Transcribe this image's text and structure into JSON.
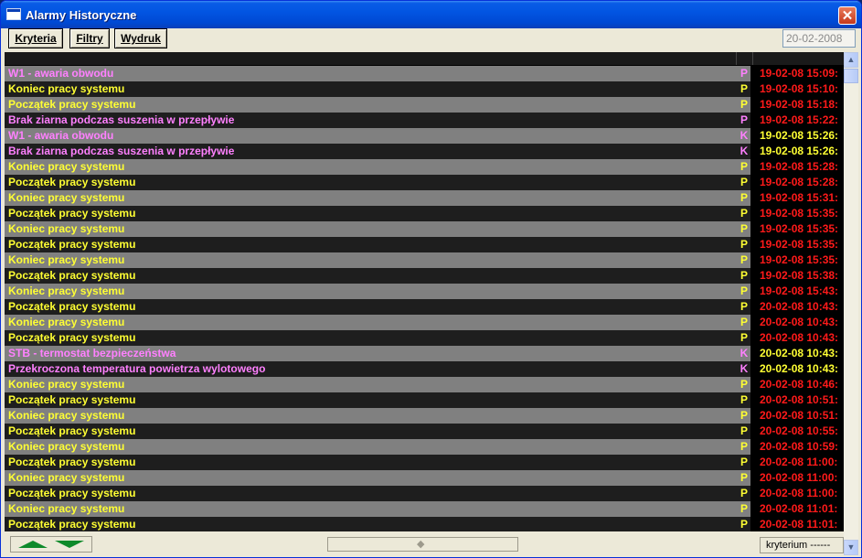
{
  "window": {
    "title": "Alarmy Historyczne",
    "close_glyph": "✕"
  },
  "toolbar": {
    "buttons": [
      {
        "label": "Kryteria"
      },
      {
        "label": "Filtry"
      },
      {
        "label": "Wydruk"
      }
    ],
    "date": "20-02-2008"
  },
  "colors": {
    "yellow": "#ffff33",
    "pink": "#ff80ff",
    "red": "#ff1a1a",
    "row_light": "#808080",
    "row_dark": "#1e1e1e"
  },
  "alarms": [
    {
      "text": "W1 - awaria obwodu",
      "type": "P",
      "date": "19-02-08  15:09:",
      "text_color": "pink",
      "date_color": "red"
    },
    {
      "text": "Koniec pracy systemu",
      "type": "P",
      "date": "19-02-08  15:10:",
      "text_color": "yellow",
      "date_color": "red"
    },
    {
      "text": "Początek pracy systemu",
      "type": "P",
      "date": "19-02-08  15:18:",
      "text_color": "yellow",
      "date_color": "red"
    },
    {
      "text": "Brak ziarna podczas suszenia w przepływie",
      "type": "P",
      "date": "19-02-08  15:22:",
      "text_color": "pink",
      "date_color": "red"
    },
    {
      "text": "W1 - awaria obwodu",
      "type": "K",
      "date": "19-02-08  15:26:",
      "text_color": "pink",
      "date_color": "yellow"
    },
    {
      "text": "Brak ziarna podczas suszenia w przepływie",
      "type": "K",
      "date": "19-02-08  15:26:",
      "text_color": "pink",
      "date_color": "yellow"
    },
    {
      "text": "Koniec pracy systemu",
      "type": "P",
      "date": "19-02-08  15:28:",
      "text_color": "yellow",
      "date_color": "red"
    },
    {
      "text": "Początek pracy systemu",
      "type": "P",
      "date": "19-02-08  15:28:",
      "text_color": "yellow",
      "date_color": "red"
    },
    {
      "text": "Koniec pracy systemu",
      "type": "P",
      "date": "19-02-08  15:31:",
      "text_color": "yellow",
      "date_color": "red"
    },
    {
      "text": "Początek pracy systemu",
      "type": "P",
      "date": "19-02-08  15:35:",
      "text_color": "yellow",
      "date_color": "red"
    },
    {
      "text": "Koniec pracy systemu",
      "type": "P",
      "date": "19-02-08  15:35:",
      "text_color": "yellow",
      "date_color": "red"
    },
    {
      "text": "Początek pracy systemu",
      "type": "P",
      "date": "19-02-08  15:35:",
      "text_color": "yellow",
      "date_color": "red"
    },
    {
      "text": "Koniec pracy systemu",
      "type": "P",
      "date": "19-02-08  15:35:",
      "text_color": "yellow",
      "date_color": "red"
    },
    {
      "text": "Początek pracy systemu",
      "type": "P",
      "date": "19-02-08  15:38:",
      "text_color": "yellow",
      "date_color": "red"
    },
    {
      "text": "Koniec pracy systemu",
      "type": "P",
      "date": "19-02-08  15:43:",
      "text_color": "yellow",
      "date_color": "red"
    },
    {
      "text": "Początek pracy systemu",
      "type": "P",
      "date": "20-02-08  10:43:",
      "text_color": "yellow",
      "date_color": "red"
    },
    {
      "text": "Koniec pracy systemu",
      "type": "P",
      "date": "20-02-08  10:43:",
      "text_color": "yellow",
      "date_color": "red"
    },
    {
      "text": "Początek pracy systemu",
      "type": "P",
      "date": "20-02-08  10:43:",
      "text_color": "yellow",
      "date_color": "red"
    },
    {
      "text": "STB - termostat bezpieczeństwa",
      "type": "K",
      "date": "20-02-08  10:43:",
      "text_color": "pink",
      "date_color": "yellow"
    },
    {
      "text": "Przekroczona temperatura powietrza wylotowego",
      "type": "K",
      "date": "20-02-08  10:43:",
      "text_color": "pink",
      "date_color": "yellow"
    },
    {
      "text": "Koniec pracy systemu",
      "type": "P",
      "date": "20-02-08  10:46:",
      "text_color": "yellow",
      "date_color": "red"
    },
    {
      "text": "Początek pracy systemu",
      "type": "P",
      "date": "20-02-08  10:51:",
      "text_color": "yellow",
      "date_color": "red"
    },
    {
      "text": "Koniec pracy systemu",
      "type": "P",
      "date": "20-02-08  10:51:",
      "text_color": "yellow",
      "date_color": "red"
    },
    {
      "text": "Początek pracy systemu",
      "type": "P",
      "date": "20-02-08  10:55:",
      "text_color": "yellow",
      "date_color": "red"
    },
    {
      "text": "Koniec pracy systemu",
      "type": "P",
      "date": "20-02-08  10:59:",
      "text_color": "yellow",
      "date_color": "red"
    },
    {
      "text": "Początek pracy systemu",
      "type": "P",
      "date": "20-02-08  11:00:",
      "text_color": "yellow",
      "date_color": "red"
    },
    {
      "text": "Koniec pracy systemu",
      "type": "P",
      "date": "20-02-08  11:00:",
      "text_color": "yellow",
      "date_color": "red"
    },
    {
      "text": "Początek pracy systemu",
      "type": "P",
      "date": "20-02-08  11:00:",
      "text_color": "yellow",
      "date_color": "red"
    },
    {
      "text": "Koniec pracy systemu",
      "type": "P",
      "date": "20-02-08  11:01:",
      "text_color": "yellow",
      "date_color": "red"
    },
    {
      "text": "Początek pracy systemu",
      "type": "P",
      "date": "20-02-08  11:01:",
      "text_color": "yellow",
      "date_color": "red"
    }
  ],
  "scrollbar": {
    "up_glyph": "▲",
    "down_glyph": "▼"
  },
  "statusbar": {
    "slider_glyph": "◆",
    "criterion": "kryterium ------"
  }
}
